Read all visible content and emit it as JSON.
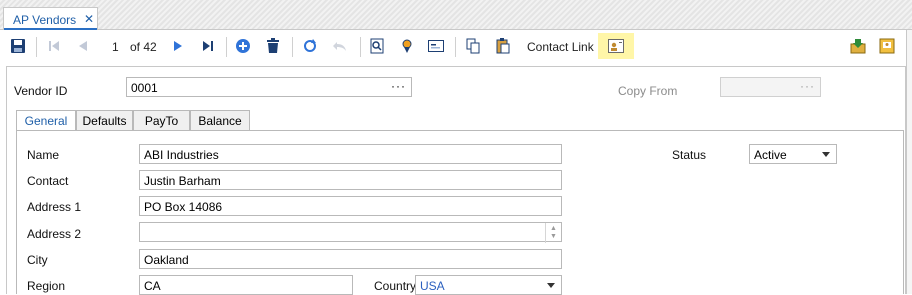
{
  "doc_tab": {
    "title": "AP Vendors",
    "close": "✕"
  },
  "toolbar": {
    "record_position": "1",
    "record_total": "of 42",
    "contact_link_label": "Contact Link",
    "icons": [
      "save-icon",
      "first-record-icon",
      "previous-record-icon",
      "next-record-icon",
      "last-record-icon",
      "add-icon",
      "delete-icon",
      "refresh-icon",
      "undo-icon",
      "search-icon",
      "locate-icon",
      "card-icon",
      "copy-icon",
      "paste-icon",
      "contact-link-icon",
      "import-icon",
      "notes-icon"
    ]
  },
  "header": {
    "vendor_id_label": "Vendor ID",
    "vendor_id_value": "0001",
    "copy_from_label": "Copy From",
    "copy_from_value": "",
    "ellipsis": "···"
  },
  "tabs": [
    {
      "label": "General",
      "active": true
    },
    {
      "label": "Defaults",
      "active": false
    },
    {
      "label": "PayTo",
      "active": false
    },
    {
      "label": "Balance",
      "active": false
    }
  ],
  "general": {
    "name_label": "Name",
    "name_value": "ABI Industries",
    "contact_label": "Contact",
    "contact_value": "Justin Barham",
    "address1_label": "Address 1",
    "address1_value": "PO Box 14086",
    "address2_label": "Address 2",
    "address2_value": "",
    "city_label": "City",
    "city_value": "Oakland",
    "region_label": "Region",
    "region_value": "CA",
    "country_label": "Country",
    "country_value": "USA",
    "status_label": "Status",
    "status_value": "Active"
  },
  "colors": {
    "accent": "#1f5fa8",
    "highlight": "#fff6a8",
    "country_text": "#2a5fbf"
  }
}
